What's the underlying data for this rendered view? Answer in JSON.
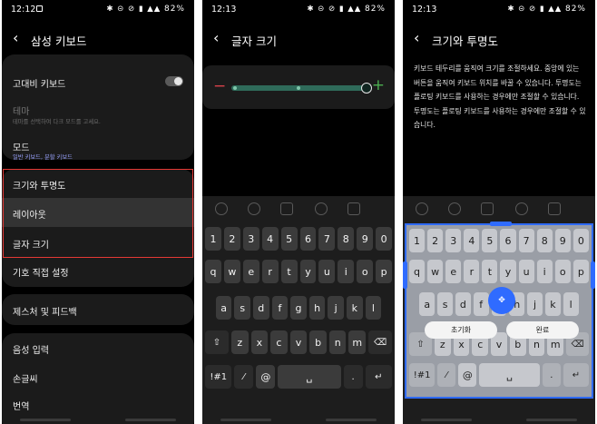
{
  "panel1": {
    "status": {
      "time": "12:12",
      "icons": "✱ ⊝ ⊘ ▮ ▲▲",
      "battery": "82%"
    },
    "title": "삼성 키보드",
    "items": [
      {
        "label": "고대비 키보드"
      },
      {
        "label": "테마",
        "sub": "테마를 선택하여 다크 모드를 고세요."
      },
      {
        "label": "모드",
        "sub": "일반 키보드, 분할 키보드"
      },
      {
        "label": "크기와 투명도"
      },
      {
        "label": "레이아웃"
      },
      {
        "label": "글자 크기"
      },
      {
        "label": "기호 직접 설정"
      },
      {
        "label": "제스처 및 피드백"
      },
      {
        "label": "음성 입력"
      },
      {
        "label": "손글씨"
      },
      {
        "label": "번역"
      }
    ]
  },
  "panel2": {
    "status": {
      "time": "12:13",
      "battery": "82%"
    },
    "title": "글자 크기",
    "minus": "−",
    "plus": "+"
  },
  "panel3": {
    "status": {
      "time": "12:13",
      "battery": "82%"
    },
    "title": "크기와 투명도",
    "description": "키보드 테두리를 움직여 크기를 조절하세요. 중앙에 있는 버튼을 움직여 키보드 위치를 바꿀 수 있습니다. 투명도는 플로팅 키보드를 사용하는 경우에만 조절할 수 있습니다. 투명도는 플로팅 키보드를 사용하는 경우에만 조절할 수 있습니다.",
    "reset_label": "초기화",
    "done_label": "완료"
  },
  "keyboard": {
    "row_numbers": [
      "1",
      "2",
      "3",
      "4",
      "5",
      "6",
      "7",
      "8",
      "9",
      "0"
    ],
    "row_q": [
      "q",
      "w",
      "e",
      "r",
      "t",
      "y",
      "u",
      "i",
      "o",
      "p"
    ],
    "row_a": [
      "a",
      "s",
      "d",
      "f",
      "g",
      "h",
      "j",
      "k",
      "l"
    ],
    "row_z": [
      "z",
      "x",
      "c",
      "v",
      "b",
      "n",
      "m"
    ],
    "shift": "⇧",
    "backspace": "⌫",
    "symbols": "!#1",
    "lang": "⁄",
    "at": "@",
    "space": "␣",
    "enter": "↵"
  },
  "colors": {
    "accent_blue": "#2f6bff",
    "highlight_red": "#e53935",
    "slider_minus": "#d8424a",
    "slider_plus": "#4caf50"
  }
}
